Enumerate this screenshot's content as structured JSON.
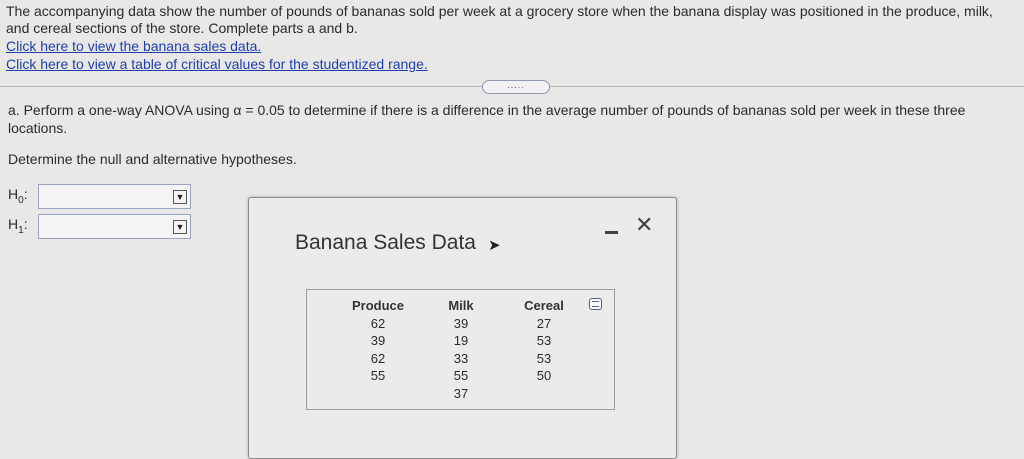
{
  "question": {
    "intro": "The accompanying data show the number of pounds of bananas sold per week at a grocery store when the banana display was positioned in the produce, milk, and cereal sections of the store. Complete parts a and b.",
    "link_data": "Click here to view the banana sales data.",
    "link_table": "Click here to view a table of critical values for the studentized range.",
    "expander": ".....",
    "part_a": "a. Perform a one-way ANOVA using α = 0.05 to determine if there is a difference in the average number of pounds of bananas sold per week in these three locations.",
    "hyp_prompt": "Determine the null and alternative hypotheses.",
    "h0_label": "H",
    "h0_sub": "0",
    "h1_label": "H",
    "h1_sub": "1",
    "colon": ":"
  },
  "popup": {
    "title": "Banana Sales Data",
    "columns": [
      {
        "header": "Produce",
        "values": [
          "62",
          "39",
          "62",
          "55"
        ]
      },
      {
        "header": "Milk",
        "values": [
          "39",
          "19",
          "33",
          "55",
          "37"
        ]
      },
      {
        "header": "Cereal",
        "values": [
          "27",
          "53",
          "53",
          "50"
        ]
      }
    ]
  },
  "colors": {
    "link": "#1d3fae",
    "background": "#e9e8e6"
  }
}
